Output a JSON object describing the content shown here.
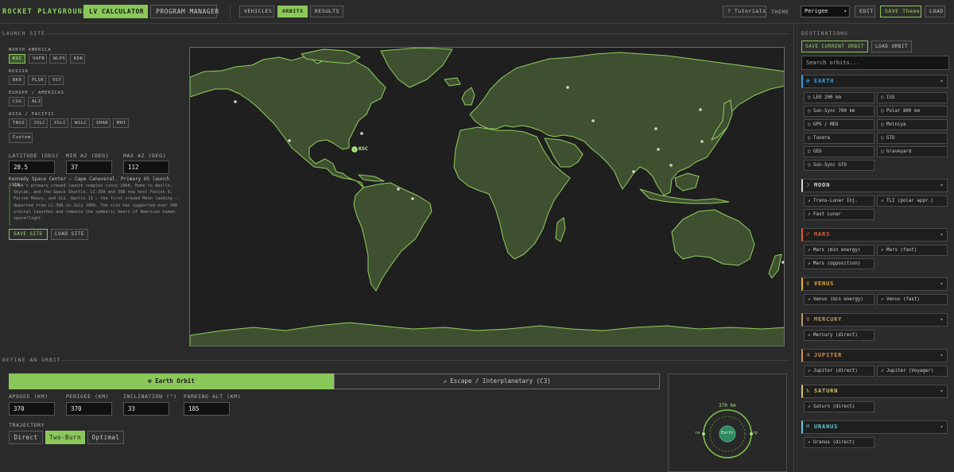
{
  "app": {
    "title": "ROCKET PLAYGROUND"
  },
  "main_tabs": [
    {
      "label": "LV CALCULATOR",
      "active": true
    },
    {
      "label": "PROGRAM MANAGER",
      "active": false
    }
  ],
  "sub_tabs": [
    {
      "label": "VEHICLES",
      "active": false
    },
    {
      "label": "ORBITS",
      "active": true
    },
    {
      "label": "RESULTS",
      "active": false
    }
  ],
  "toolbar": {
    "tutorials": "? Tutorials",
    "theme_label": "THEME",
    "theme_value": "Perigee",
    "edit": "EDIT",
    "save_theme": "SAVE Theme",
    "load": "LOAD"
  },
  "launch_site": {
    "section_title": "LAUNCH SITE",
    "groups": [
      {
        "label": "NORTH AMERICA",
        "sites": [
          "KSC",
          "VAFB",
          "WLPS",
          "KDK"
        ]
      },
      {
        "label": "RUSSIA",
        "sites": [
          "BKR",
          "PLSK",
          "VST"
        ]
      },
      {
        "label": "EUROPE / AMERICAS",
        "sites": [
          "CSG",
          "ALZ"
        ]
      },
      {
        "label": "ASIA / PACIFIC",
        "sites": [
          "TNGS",
          "JSLC",
          "XSLC",
          "WSLC",
          "SHAR",
          "MHI"
        ]
      }
    ],
    "selected": "KSC",
    "custom": "Custom",
    "latitude_label": "LATITUDE (DEG)",
    "latitude": "28.5",
    "min_az_label": "MIN AZ (DEG)",
    "min_az": "37",
    "max_az_label": "MAX AZ (DEG)",
    "max_az": "112",
    "site_title": "Kennedy Space Center — Cape Canaveral. Primary US launch site.",
    "description": "NASA's primary crewed launch complex since 1968. Home to Apollo, Skylab, and the Space Shuttle. LC-39A and 39B now host Falcon 9, Falcon Heavy, and SLS. Apollo 11 — the first crewed Moon landing — departed from LC-39A in July 1969. The site has supported over 200 orbital launches and remains the symbolic heart of American human spaceflight.",
    "save_site": "SAVE SITE",
    "load_site": "LOAD SITE",
    "map_marker": "KSC"
  },
  "destinations": {
    "section_title": "DESTINATIONS",
    "save_current": "SAVE CURRENT ORBIT",
    "load_orbit": "LOAD ORBIT",
    "search_placeholder": "Search orbits...",
    "bodies": [
      {
        "name": "EARTH",
        "color": "#3aa0e0",
        "icon": "⊕",
        "item_icon": "○",
        "items": [
          "LEO 200 km",
          "ISS",
          "Sun-Sync 700 km",
          "Polar 800 km",
          "GPS / MEO",
          "Molniya",
          "Tundra",
          "GTO",
          "GEO",
          "Graveyard",
          "Sun-Sync GTO"
        ]
      },
      {
        "name": "MOON",
        "color": "#d8d8d8",
        "icon": "☽",
        "item_icon": "↗",
        "items": [
          "Trans-Lunar Inj.",
          "TLI (polar appr.)",
          "Fast Lunar"
        ]
      },
      {
        "name": "MARS",
        "color": "#e0603a",
        "icon": "♂",
        "item_icon": "↗",
        "items": [
          "Mars (min energy)",
          "Mars (fast)",
          "Mars (opposition)"
        ]
      },
      {
        "name": "VENUS",
        "color": "#e8b030",
        "icon": "♀",
        "item_icon": "↗",
        "items": [
          "Venus (min energy)",
          "Venus (fast)"
        ]
      },
      {
        "name": "MERCURY",
        "color": "#b89a70",
        "icon": "☿",
        "item_icon": "↗",
        "items": [
          "Mercury (direct)"
        ]
      },
      {
        "name": "JUPITER",
        "color": "#d89050",
        "icon": "♃",
        "item_icon": "↗",
        "items": [
          "Jupiter (direct)",
          "Jupiter (Voyager)"
        ]
      },
      {
        "name": "SATURN",
        "color": "#d8c070",
        "icon": "♄",
        "item_icon": "↗",
        "items": [
          "Saturn (direct)"
        ]
      },
      {
        "name": "URANUS",
        "color": "#60c8d8",
        "icon": "♅",
        "item_icon": "↗",
        "items": [
          "Uranus (direct)"
        ]
      }
    ]
  },
  "define_orbit": {
    "section_title": "DEFINE AN ORBIT",
    "mode_earth": "⊕ Earth Orbit",
    "mode_escape": "↗ Escape / Interplanetary (C3)",
    "apogee_label": "APOGEE (KM)",
    "apogee": "370",
    "perigee_label": "PERIGEE (KM)",
    "perigee": "370",
    "inclination_label": "INCLINATION (°)",
    "inclination": "33",
    "parking_label": "PARKING ALT (KM)",
    "parking": "185",
    "trajectory_label": "TRAJECTORY",
    "trajectory_options": [
      "Direct",
      "Two-Burn",
      "Optimal"
    ],
    "trajectory_selected": "Two-Burn",
    "preview": {
      "altitude_label": "370 km",
      "center_label": "Earth",
      "left_label": "ra",
      "right_label": "rp"
    }
  }
}
